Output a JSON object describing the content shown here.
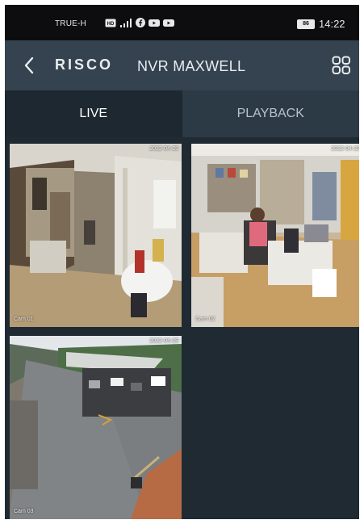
{
  "status_bar": {
    "carrier": "TRUE-H",
    "battery": "86",
    "time": "14:22",
    "icons": [
      "hd-icon",
      "signal-icon",
      "facebook-icon",
      "youtube-icon",
      "youtube-icon"
    ]
  },
  "header": {
    "back_icon": "chevron-left-icon",
    "logo": "RISCO",
    "title": "NVR MAXWELL",
    "grid_icon": "grid-view-icon"
  },
  "tabs": [
    {
      "label": "LIVE",
      "active": true
    },
    {
      "label": "PLAYBACK",
      "active": false
    }
  ],
  "cameras": [
    {
      "timestamp": "2022-04-29",
      "label": "Cam 01"
    },
    {
      "timestamp": "2022-04-29",
      "label": "Cam 02"
    },
    {
      "timestamp": "2022-04-29",
      "label": "Cam 03"
    }
  ],
  "colors": {
    "status_bar": "#0d0d0f",
    "header": "#34434f",
    "tab_active": "#1d2830",
    "tab_inactive": "#2c3a45",
    "background": "#1f2a33"
  }
}
